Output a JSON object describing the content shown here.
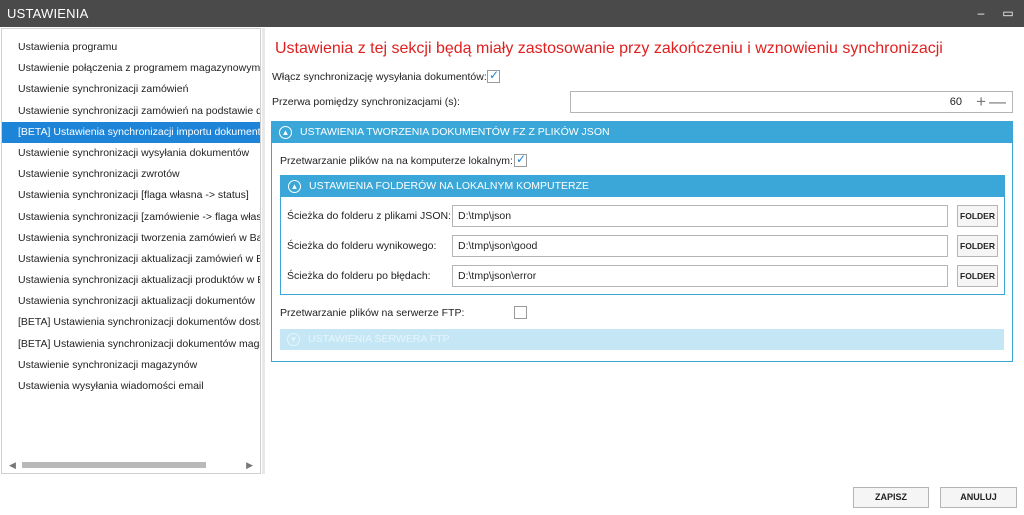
{
  "window": {
    "title": "USTAWIENIA",
    "minimize_icon": "minimize-icon",
    "maximize_icon": "maximize-icon"
  },
  "sidebar": {
    "selected_index": 4,
    "items": [
      {
        "label": "Ustawienia programu"
      },
      {
        "label": "Ustawienie połączenia z programem magazynowym"
      },
      {
        "label": "Ustawienie synchronizacji zamówień"
      },
      {
        "label": "Ustawienie synchronizacji zamówień na podstawie dzi"
      },
      {
        "label": "[BETA] Ustawienia synchronizacji importu dokumentó"
      },
      {
        "label": "Ustawienie synchronizacji wysyłania dokumentów"
      },
      {
        "label": "Ustawienie synchronizacji zwrotów"
      },
      {
        "label": "Ustawienia synchronizacji [flaga własna -> status]"
      },
      {
        "label": "Ustawienia synchronizacji [zamówienie -> flaga własn"
      },
      {
        "label": "Ustawienia synchronizacji tworzenia zamówień w Base"
      },
      {
        "label": "Ustawienia synchronizacji aktualizacji zamówień w Ba"
      },
      {
        "label": "Ustawienia synchronizacji aktualizacji produktów w Ba"
      },
      {
        "label": "Ustawienia synchronizacji aktualizacji dokumentów"
      },
      {
        "label": "[BETA] Ustawienia synchronizacji dokumentów dostaw"
      },
      {
        "label": "[BETA] Ustawienia synchronizacji dokumentów magaz"
      },
      {
        "label": "Ustawienie synchronizacji magazynów"
      },
      {
        "label": "Ustawienia wysyłania wiadomości email"
      }
    ]
  },
  "main": {
    "headline": "Ustawienia z tej sekcji będą miały zastosowanie przy zakończeniu i wznowieniu synchronizacji",
    "enable_sync_label": "Włącz synchronizację wysyłania dokumentów:",
    "enable_sync_checked": true,
    "interval_label": "Przerwa pomiędzy synchronizacjami (s):",
    "interval_value": "60",
    "json_group": {
      "header": "USTAWIENIA TWORZENIA DOKUMENTÓW FZ Z PLIKÓW JSON",
      "local_label": "Przetwarzanie plików na na komputerze lokalnym:",
      "local_checked": true,
      "folders_group": {
        "header": "USTAWIENIA FOLDERÓW NA LOKALNYM KOMPUTERZE",
        "rows": [
          {
            "label": "Ścieżka do folderu z plikami JSON:",
            "value": "D:\\tmp\\json",
            "button": "FOLDER"
          },
          {
            "label": "Ścieżka do folderu wynikowego:",
            "value": "D:\\tmp\\json\\good",
            "button": "FOLDER"
          },
          {
            "label": "Ścieżka do folderu po błędach:",
            "value": "D:\\tmp\\json\\error",
            "button": "FOLDER"
          }
        ]
      },
      "ftp_label": "Przetwarzanie plików na serwerze FTP:",
      "ftp_checked": false,
      "ftp_group_header": "USTAWIENIA SERWERA FTP"
    }
  },
  "footer": {
    "save_label": "ZAPISZ",
    "cancel_label": "ANULUJ"
  },
  "colors": {
    "accent": "#3aa7d8",
    "selected": "#1e84d8",
    "headline": "#e02020",
    "titlebar": "#4a4a4a"
  }
}
